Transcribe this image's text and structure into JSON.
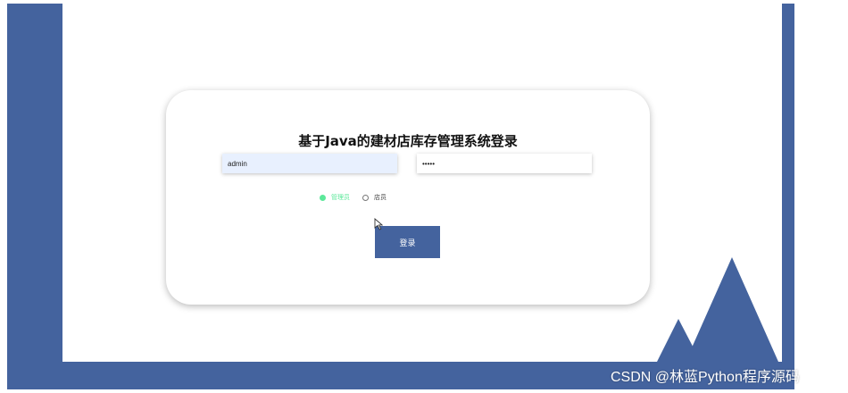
{
  "login": {
    "title": "基于Java的建材店库存管理系统登录",
    "username_value": "admin",
    "password_value": "•••••",
    "roles": [
      {
        "label": "管理员",
        "selected": true
      },
      {
        "label": "店员",
        "selected": false
      }
    ],
    "submit_label": "登录"
  },
  "watermark": {
    "text": "CSDN @林蓝Python程序源码"
  },
  "colors": {
    "brand": "#44639e",
    "selected_radio": "#5ce89a",
    "card_background": "#ffffff",
    "username_background": "#e8f0fe"
  },
  "icons": {
    "cursor": "mouse-pointer-icon",
    "decoration": "mountain-shapes"
  }
}
